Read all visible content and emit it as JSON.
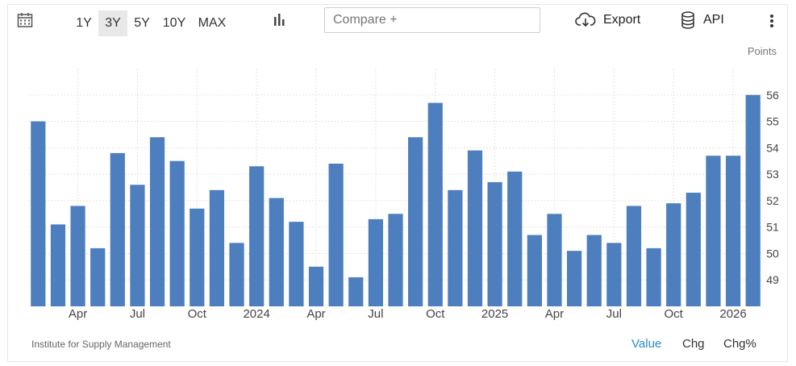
{
  "toolbar": {
    "calendar_icon": "calendar-icon",
    "ranges": [
      "1Y",
      "3Y",
      "5Y",
      "10Y",
      "MAX"
    ],
    "active_range": "3Y",
    "chart_type_icon": "bar-chart-icon",
    "compare_placeholder": "Compare +",
    "export_label": "Export",
    "export_icon": "cloud-download-icon",
    "api_label": "API",
    "api_icon": "database-icon",
    "more_icon": "vertical-dots-icon"
  },
  "units_label": "Points",
  "source": "Institute for Supply Management",
  "footer_tabs": [
    "Value",
    "Chg",
    "Chg%"
  ],
  "active_footer_tab": "Value",
  "colors": {
    "bar": "#4d7fbe",
    "active_tab": "#2a8ac9",
    "grid": "#e3e3e3"
  },
  "chart_data": {
    "type": "bar",
    "values": [
      55.0,
      51.1,
      51.8,
      50.2,
      53.8,
      52.6,
      54.4,
      53.5,
      51.7,
      52.4,
      50.4,
      53.3,
      52.1,
      51.2,
      49.5,
      53.4,
      49.1,
      51.3,
      51.5,
      54.4,
      55.7,
      52.4,
      53.9,
      52.7,
      53.1,
      50.7,
      51.5,
      50.1,
      50.7,
      50.4,
      51.8,
      50.2,
      51.9,
      52.3,
      53.7,
      53.7,
      56.0
    ],
    "x_tick_labels": [
      {
        "index": 2,
        "label": "Apr"
      },
      {
        "index": 5,
        "label": "Jul"
      },
      {
        "index": 8,
        "label": "Oct"
      },
      {
        "index": 11,
        "label": "2024"
      },
      {
        "index": 14,
        "label": "Apr"
      },
      {
        "index": 17,
        "label": "Jul"
      },
      {
        "index": 20,
        "label": "Oct"
      },
      {
        "index": 23,
        "label": "2025"
      },
      {
        "index": 26,
        "label": "Apr"
      },
      {
        "index": 29,
        "label": "Jul"
      },
      {
        "index": 32,
        "label": "Oct"
      },
      {
        "index": 35,
        "label": "2026"
      }
    ],
    "y_ticks": [
      49,
      50,
      51,
      52,
      53,
      54,
      55,
      56
    ],
    "ylim": [
      48.0,
      57.0
    ],
    "grid": true
  }
}
